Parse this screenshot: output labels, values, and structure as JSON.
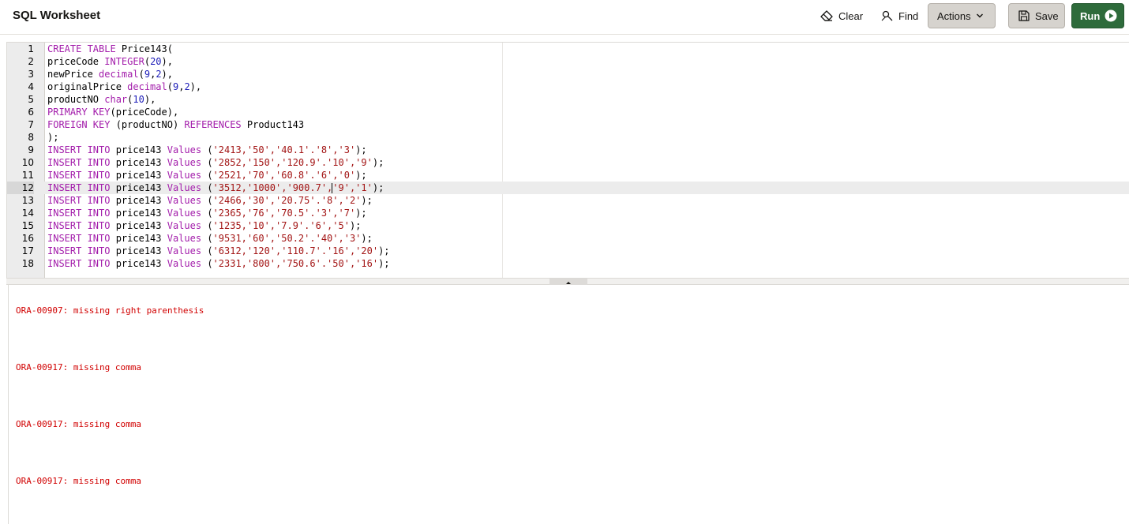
{
  "header": {
    "title": "SQL Worksheet",
    "clear_label": "Clear",
    "find_label": "Find",
    "actions_label": "Actions",
    "save_label": "Save",
    "run_label": "Run"
  },
  "icons": {
    "clear": "eraser-icon",
    "find": "find-icon",
    "actions": "chevron-down-icon",
    "save": "save-icon",
    "run": "play-circle-icon"
  },
  "colors": {
    "run_button": "#2e6b3b",
    "keyword": "#a31dab",
    "number": "#1c1cb8",
    "string": "#a31515",
    "error": "#d10000"
  },
  "editor": {
    "active_line": 12,
    "lines": [
      [
        [
          "k",
          "CREATE TABLE"
        ],
        [
          "p",
          " Price143("
        ]
      ],
      [
        [
          "p",
          "priceCode "
        ],
        [
          "k",
          "INTEGER"
        ],
        [
          "p",
          "("
        ],
        [
          "n",
          "20"
        ],
        [
          "p",
          "),"
        ]
      ],
      [
        [
          "p",
          "newPrice "
        ],
        [
          "k",
          "decimal"
        ],
        [
          "p",
          "("
        ],
        [
          "n",
          "9"
        ],
        [
          "p",
          ","
        ],
        [
          "n",
          "2"
        ],
        [
          "p",
          "),"
        ]
      ],
      [
        [
          "p",
          "originalPrice "
        ],
        [
          "k",
          "decimal"
        ],
        [
          "p",
          "("
        ],
        [
          "n",
          "9"
        ],
        [
          "p",
          ","
        ],
        [
          "n",
          "2"
        ],
        [
          "p",
          "),"
        ]
      ],
      [
        [
          "p",
          "productNO "
        ],
        [
          "k",
          "char"
        ],
        [
          "p",
          "("
        ],
        [
          "n",
          "10"
        ],
        [
          "p",
          "),"
        ]
      ],
      [
        [
          "k",
          "PRIMARY KEY"
        ],
        [
          "p",
          "(priceCode),"
        ]
      ],
      [
        [
          "k",
          "FOREIGN KEY"
        ],
        [
          "p",
          " (productNO) "
        ],
        [
          "k",
          "REFERENCES"
        ],
        [
          "p",
          " Product143"
        ]
      ],
      [
        [
          "p",
          ");"
        ]
      ],
      [
        [
          "k",
          "INSERT INTO"
        ],
        [
          "p",
          " price143 "
        ],
        [
          "k",
          "Values"
        ],
        [
          "p",
          " ("
        ],
        [
          "s",
          "'2413,'50','40.1'.'8','3'"
        ],
        [
          "p",
          ");"
        ]
      ],
      [
        [
          "k",
          "INSERT INTO"
        ],
        [
          "p",
          " price143 "
        ],
        [
          "k",
          "Values"
        ],
        [
          "p",
          " ("
        ],
        [
          "s",
          "'2852,'150','120.9'.'10','9'"
        ],
        [
          "p",
          ");"
        ]
      ],
      [
        [
          "k",
          "INSERT INTO"
        ],
        [
          "p",
          " price143 "
        ],
        [
          "k",
          "Values"
        ],
        [
          "p",
          " ("
        ],
        [
          "s",
          "'2521,'70','60.8'.'6','0'"
        ],
        [
          "p",
          ");"
        ]
      ],
      [
        [
          "k",
          "INSERT INTO"
        ],
        [
          "p",
          " price143 "
        ],
        [
          "k",
          "Values"
        ],
        [
          "p",
          " ("
        ],
        [
          "s",
          "'3512,'1000','900.7',"
        ],
        [
          "c",
          ""
        ],
        [
          "s",
          "'9','1'"
        ],
        [
          "p",
          ");"
        ]
      ],
      [
        [
          "k",
          "INSERT INTO"
        ],
        [
          "p",
          " price143 "
        ],
        [
          "k",
          "Values"
        ],
        [
          "p",
          " ("
        ],
        [
          "s",
          "'2466,'30','20.75'.'8','2'"
        ],
        [
          "p",
          ");"
        ]
      ],
      [
        [
          "k",
          "INSERT INTO"
        ],
        [
          "p",
          " price143 "
        ],
        [
          "k",
          "Values"
        ],
        [
          "p",
          " ("
        ],
        [
          "s",
          "'2365,'76','70.5'.'3','7'"
        ],
        [
          "p",
          ");"
        ]
      ],
      [
        [
          "k",
          "INSERT INTO"
        ],
        [
          "p",
          " price143 "
        ],
        [
          "k",
          "Values"
        ],
        [
          "p",
          " ("
        ],
        [
          "s",
          "'1235,'10','7.9'.'6','5'"
        ],
        [
          "p",
          ");"
        ]
      ],
      [
        [
          "k",
          "INSERT INTO"
        ],
        [
          "p",
          " price143 "
        ],
        [
          "k",
          "Values"
        ],
        [
          "p",
          " ("
        ],
        [
          "s",
          "'9531,'60','50.2'.'40','3'"
        ],
        [
          "p",
          ");"
        ]
      ],
      [
        [
          "k",
          "INSERT INTO"
        ],
        [
          "p",
          " price143 "
        ],
        [
          "k",
          "Values"
        ],
        [
          "p",
          " ("
        ],
        [
          "s",
          "'6312,'120','110.7'.'16','20'"
        ],
        [
          "p",
          ");"
        ]
      ],
      [
        [
          "k",
          "INSERT INTO"
        ],
        [
          "p",
          " price143 "
        ],
        [
          "k",
          "Values"
        ],
        [
          "p",
          " ("
        ],
        [
          "s",
          "'2331,'800','750.6'.'50','16'"
        ],
        [
          "p",
          ");"
        ]
      ]
    ]
  },
  "results": {
    "messages": [
      "ORA-00907: missing right parenthesis",
      "ORA-00917: missing comma",
      "ORA-00917: missing comma",
      "ORA-00917: missing comma"
    ]
  }
}
